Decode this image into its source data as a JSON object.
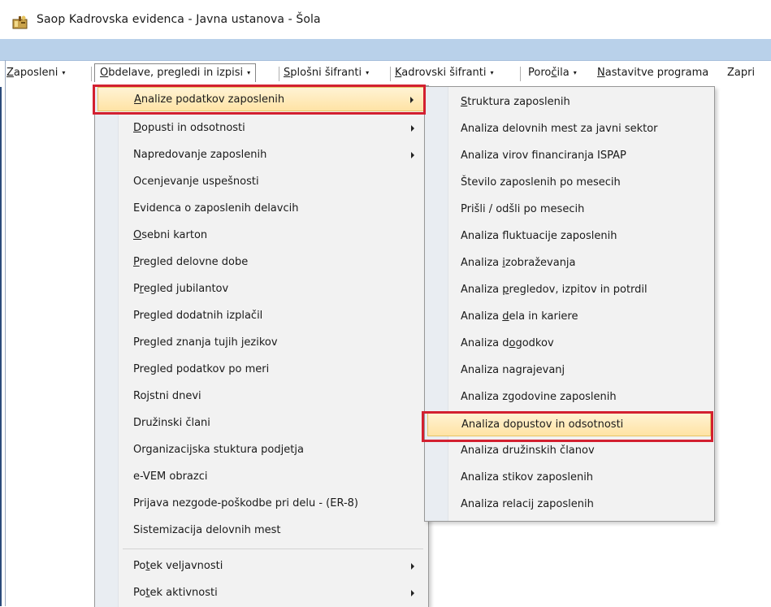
{
  "window": {
    "title": "Saop Kadrovska evidenca  - Javna ustanova - Šola"
  },
  "menubar": {
    "items": [
      {
        "pre": "",
        "u": "Z",
        "post": "aposleni",
        "caret": "▾"
      },
      {
        "pre": "",
        "u": "O",
        "post": "bdelave, pregledi in izpisi",
        "caret": "▾"
      },
      {
        "pre": "",
        "u": "S",
        "post": "plošni šifranti",
        "caret": "▾"
      },
      {
        "pre": "",
        "u": "K",
        "post": "adrovski šifranti",
        "caret": "▾"
      },
      {
        "pre": "Poro",
        "u": "č",
        "post": "ila",
        "caret": "▾"
      },
      {
        "pre": "",
        "u": "N",
        "post": "astavitve programa",
        "caret": ""
      },
      {
        "pre": "Zapri",
        "u": "",
        "post": "",
        "caret": ""
      }
    ]
  },
  "menu1": {
    "items": [
      {
        "pre": "",
        "u": "A",
        "post": "nalize podatkov zaposlenih",
        "submenu": true,
        "highlighted": true
      },
      {
        "pre": "",
        "u": "D",
        "post": "opusti in odsotnosti",
        "submenu": true
      },
      {
        "pre": "Napredovanje zaposlenih",
        "u": "",
        "post": "",
        "submenu": true
      },
      {
        "pre": "Ocenjevanje uspešnosti",
        "u": "",
        "post": ""
      },
      {
        "pre": "Evidenca o zaposlenih delavcih",
        "u": "",
        "post": ""
      },
      {
        "pre": "",
        "u": "O",
        "post": "sebni karton"
      },
      {
        "pre": "",
        "u": "P",
        "post": "regled delovne dobe"
      },
      {
        "pre": "P",
        "u": "r",
        "post": "egled jubilantov"
      },
      {
        "pre": "Pregled dodatnih izplačil",
        "u": "",
        "post": ""
      },
      {
        "pre": "Pregled znanja tujih jezikov",
        "u": "",
        "post": ""
      },
      {
        "pre": "Pregled podatkov po meri",
        "u": "",
        "post": ""
      },
      {
        "pre": "Rojstni dnevi",
        "u": "",
        "post": ""
      },
      {
        "pre": "Družinski člani",
        "u": "",
        "post": ""
      },
      {
        "pre": "Organizacijska stuktura podjetja",
        "u": "",
        "post": ""
      },
      {
        "pre": "e-VEM obrazci",
        "u": "",
        "post": ""
      },
      {
        "pre": "Prijava nezgode-poškodbe pri delu - (ER-8)",
        "u": "",
        "post": ""
      },
      {
        "pre": "Sistemizacija delovnih mest",
        "u": "",
        "post": ""
      },
      {
        "pre": "Po",
        "u": "t",
        "post": "ek veljavnosti",
        "submenu": true
      },
      {
        "pre": "Po",
        "u": "t",
        "post": "ek aktivnosti",
        "submenu": true
      }
    ]
  },
  "menu2": {
    "items": [
      {
        "pre": "",
        "u": "S",
        "post": "truktura zaposlenih"
      },
      {
        "pre": "Analiza delovnih mest za javni sektor",
        "u": "",
        "post": ""
      },
      {
        "pre": "Analiza virov financiranja ISPAP",
        "u": "",
        "post": ""
      },
      {
        "pre": "Število zaposlenih po mesecih",
        "u": "",
        "post": ""
      },
      {
        "pre": "Prišli / odšli po mesecih",
        "u": "",
        "post": ""
      },
      {
        "pre": "Analiza fluktuacije zaposlenih",
        "u": "",
        "post": ""
      },
      {
        "pre": "Analiza ",
        "u": "i",
        "post": "zobraževanja"
      },
      {
        "pre": "Analiza ",
        "u": "p",
        "post": "regledov, izpitov in potrdil"
      },
      {
        "pre": "Analiza ",
        "u": "d",
        "post": "ela in kariere"
      },
      {
        "pre": "Analiza d",
        "u": "o",
        "post": "godkov"
      },
      {
        "pre": "Analiza nagrajevanj",
        "u": "",
        "post": ""
      },
      {
        "pre": "Analiza zgodovine zaposlenih",
        "u": "",
        "post": ""
      },
      {
        "pre": "Analiza dopustov in odsotnosti",
        "u": "",
        "post": "",
        "highlighted": true
      },
      {
        "pre": "Analiza družinskih članov",
        "u": "",
        "post": ""
      },
      {
        "pre": "Analiza stikov zaposlenih",
        "u": "",
        "post": ""
      },
      {
        "pre": "Analiza relacij zaposlenih",
        "u": "",
        "post": ""
      }
    ]
  },
  "colors": {
    "highlight_border": "#d32030",
    "hover_fill": "#ffe3a5"
  }
}
